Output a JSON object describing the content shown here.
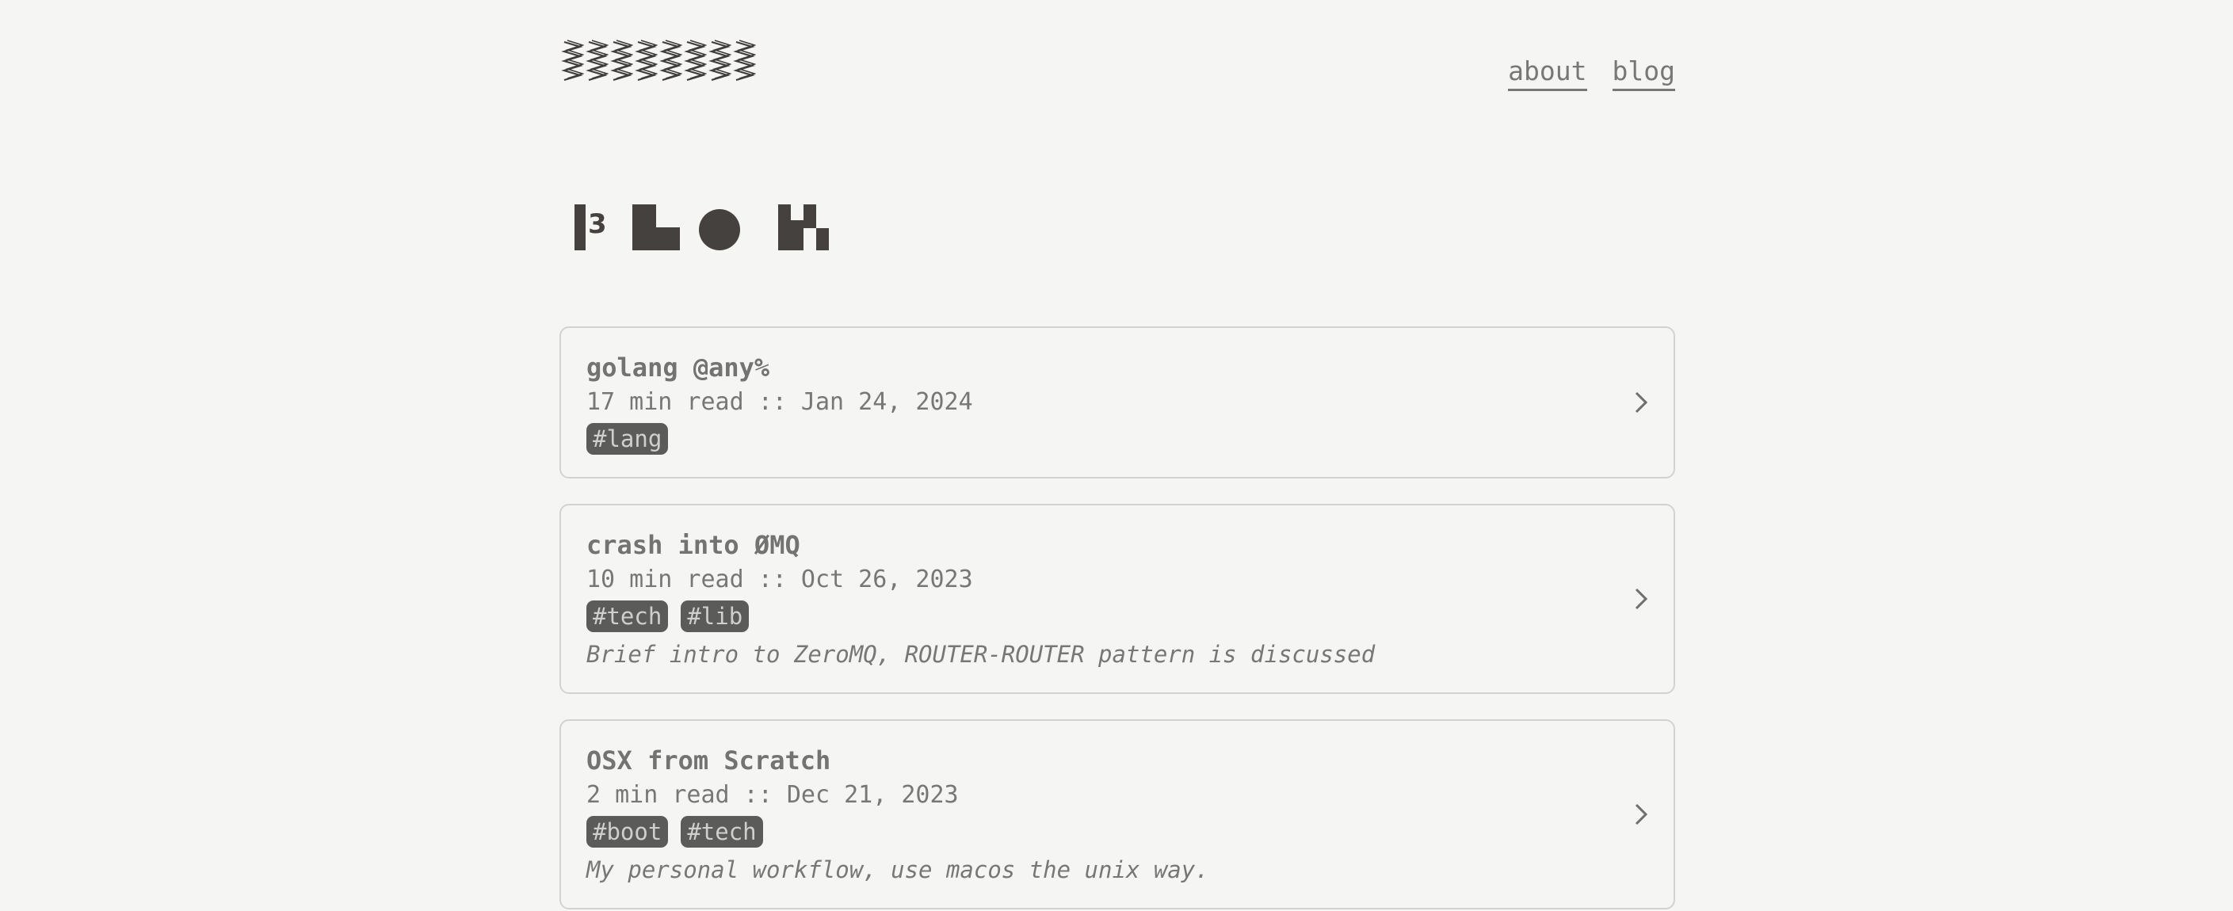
{
  "header": {
    "logo_icon": "zigzag-logo",
    "nav": [
      {
        "label": "about"
      },
      {
        "label": "blog"
      }
    ]
  },
  "page_title": {
    "text": "blog",
    "style": "geometric block glyphs"
  },
  "posts": [
    {
      "title": "golang @any%",
      "meta": "17 min read :: Jan 24, 2024",
      "tags": [
        "#lang"
      ],
      "description": ""
    },
    {
      "title": "crash into ØMQ",
      "meta": "10 min read :: Oct 26, 2023",
      "tags": [
        "#tech",
        "#lib"
      ],
      "description": "Brief intro to ZeroMQ, ROUTER-ROUTER pattern is discussed"
    },
    {
      "title": "OSX from Scratch",
      "meta": "2 min read :: Dec 21, 2023",
      "tags": [
        "#boot",
        "#tech"
      ],
      "description": "My personal workflow, use macos the unix way."
    }
  ],
  "icons": {
    "chevron": "chevron-right-icon"
  },
  "colors": {
    "background": "#f5f5f3",
    "text": "#777776",
    "tag_bg": "#5b5b59",
    "tag_text": "#cfcfcd",
    "card_border": "#d2d2d0",
    "title_glyph": "#45413e"
  }
}
